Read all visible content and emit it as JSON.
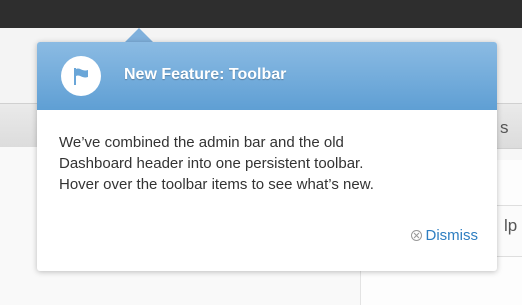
{
  "background": {
    "admin_bar_color": "#2e2e2e",
    "right_text_s": "s",
    "right_text_ip": "lp"
  },
  "pointer": {
    "title": "New Feature: Toolbar",
    "icon": "flag-icon",
    "body_lines": [
      "We’ve combined the admin bar and the old",
      "Dashboard header into one persistent toolbar.",
      "Hover over the toolbar items to see what’s new."
    ],
    "dismiss_label": "Dismiss",
    "dismiss_icon": "close-circle-icon",
    "header_color": "#6aa6d8",
    "link_color": "#2e7ec1"
  }
}
